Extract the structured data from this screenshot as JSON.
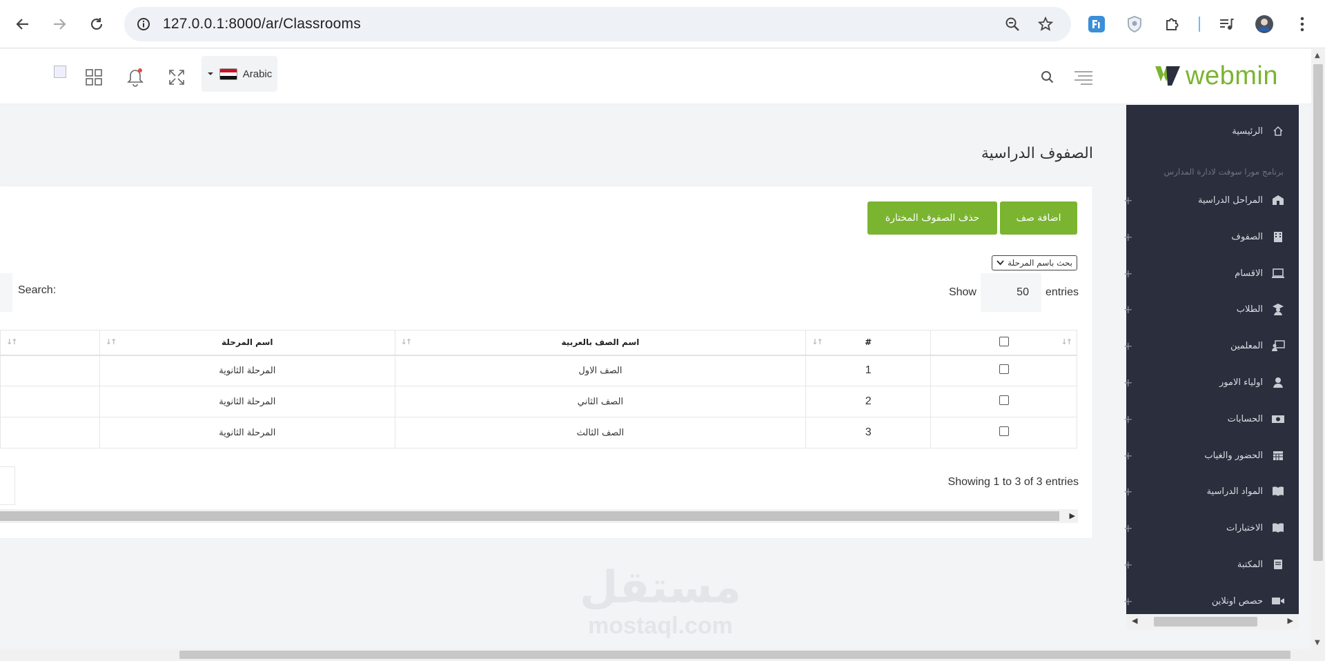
{
  "browser": {
    "url": "127.0.0.1:8000/ar/Classrooms"
  },
  "header": {
    "brand": "webmin",
    "language": "Arabic"
  },
  "sidebar": {
    "caption": "برنامج مورا سوفت لادارة المدارس",
    "items": [
      {
        "label": "الرئيسية",
        "icon": "home-icon",
        "expandable": false
      },
      {
        "label": "المراحل الدراسية",
        "icon": "school-icon",
        "expandable": true
      },
      {
        "label": "الصفوف",
        "icon": "building-icon",
        "expandable": true
      },
      {
        "label": "الاقسام",
        "icon": "laptop-icon",
        "expandable": true
      },
      {
        "label": "الطلاب",
        "icon": "graduate-icon",
        "expandable": true
      },
      {
        "label": "المعلمين",
        "icon": "teacher-icon",
        "expandable": true
      },
      {
        "label": "اولياء الامور",
        "icon": "user-icon",
        "expandable": true
      },
      {
        "label": "الحسابات",
        "icon": "money-icon",
        "expandable": true
      },
      {
        "label": "الحضور والغياب",
        "icon": "calendar-icon",
        "expandable": true
      },
      {
        "label": "المواد الدراسية",
        "icon": "book-icon",
        "expandable": true
      },
      {
        "label": "الاختبارات",
        "icon": "book-open-icon",
        "expandable": true
      },
      {
        "label": "المكتبة",
        "icon": "library-icon",
        "expandable": true
      },
      {
        "label": "حصص اونلاين",
        "icon": "video-icon",
        "expandable": true
      }
    ]
  },
  "page": {
    "title": "الصفوف الدراسية",
    "add_button": "اضافة صف",
    "delete_button": "حذف الصفوف المختارة",
    "stage_filter": "بحث باسم المرحلة",
    "show_label": "Show",
    "entries_value": "50",
    "entries_label": "entries",
    "search_label": "Search:",
    "info": "Showing 1 to 3 of 3 entries"
  },
  "table": {
    "columns": [
      "#",
      "اسم الصف بالعربية",
      "اسم المرحلة"
    ],
    "rows": [
      {
        "num": "1",
        "name": "الصف الاول",
        "stage": "المرحلة الثانوية"
      },
      {
        "num": "2",
        "name": "الصف الثاني",
        "stage": "المرحلة الثانوية"
      },
      {
        "num": "3",
        "name": "الصف الثالث",
        "stage": "المرحلة الثانوية"
      }
    ]
  },
  "watermark": {
    "arabic": "مستقل",
    "latin": "mostaql.com"
  },
  "colors": {
    "accent": "#7ab430",
    "sidebar": "#2a2e3d"
  }
}
